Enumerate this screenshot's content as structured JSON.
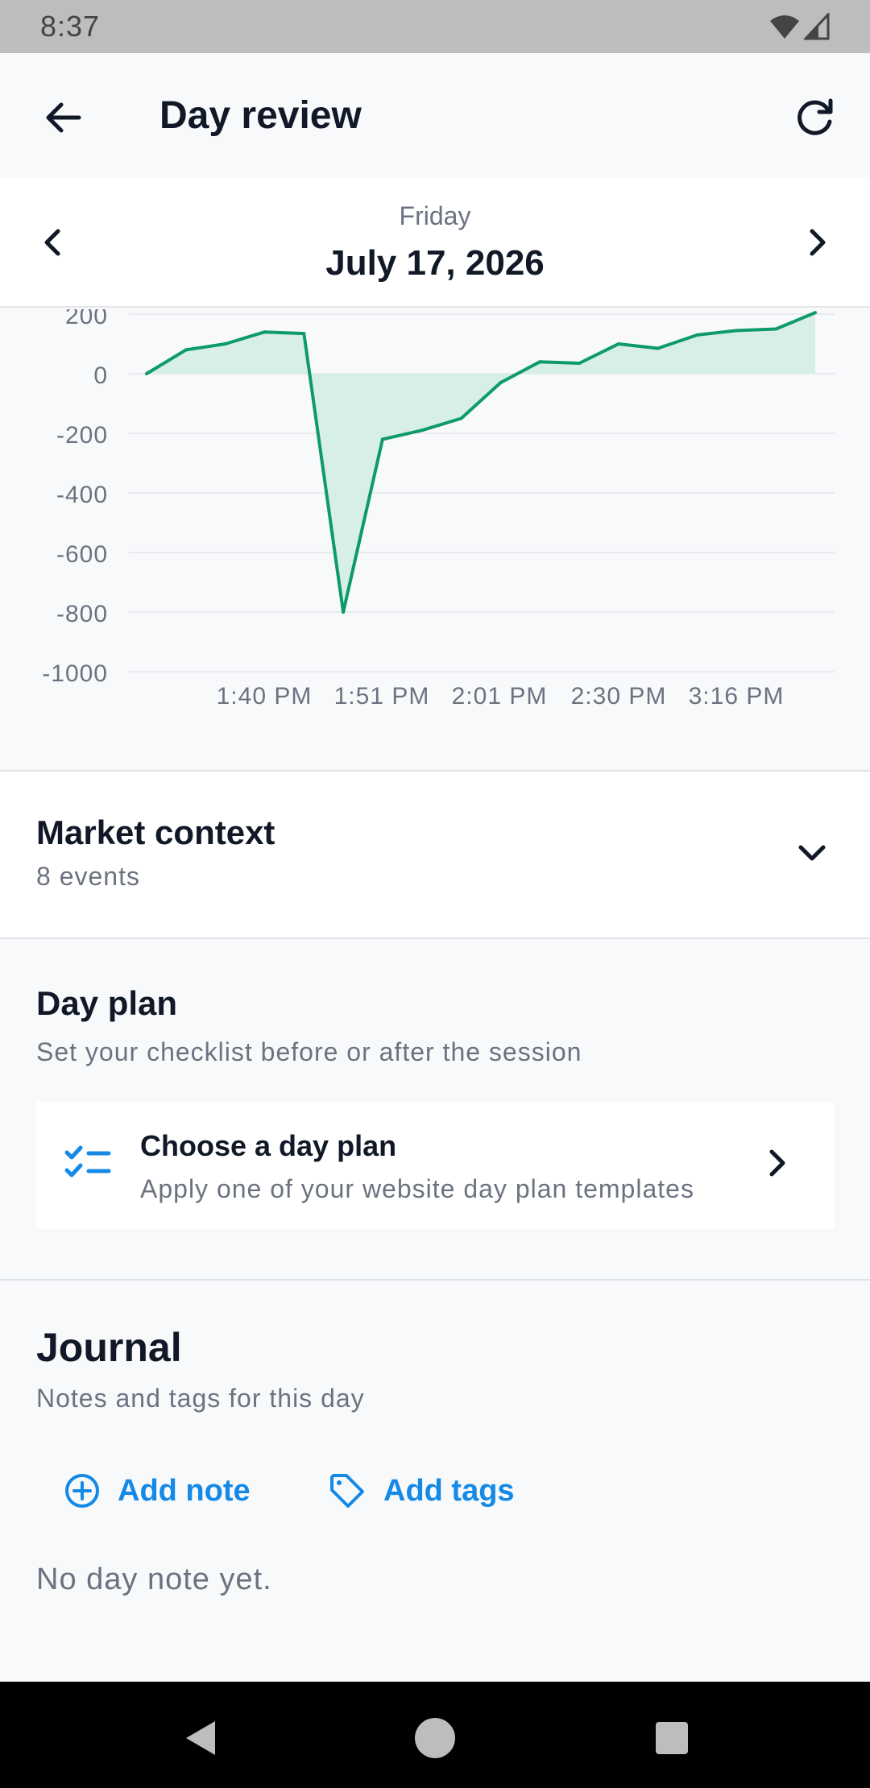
{
  "status_bar": {
    "time": "8:37"
  },
  "header": {
    "title": "Day review"
  },
  "date_nav": {
    "weekday": "Friday",
    "date": "July 17, 2026"
  },
  "chart_data": {
    "type": "area",
    "title": "",
    "xlabel": "",
    "ylabel": "",
    "ylim": [
      -1000,
      200
    ],
    "y_ticks": [
      "200",
      "0",
      "-200",
      "-400",
      "-600",
      "-800",
      "-1000"
    ],
    "y_tick_values": [
      200,
      0,
      -200,
      -400,
      -600,
      -800,
      -1000
    ],
    "x_ticks": [
      "1:40 PM",
      "1:51 PM",
      "2:01 PM",
      "2:30 PM",
      "3:16 PM"
    ],
    "grid": true,
    "series": [
      {
        "color": "#0e9a6b",
        "fill": "#d7efe6",
        "values": [
          0,
          80,
          100,
          140,
          135,
          -800,
          -220,
          -190,
          -150,
          -30,
          40,
          35,
          100,
          85,
          130,
          145,
          150,
          205
        ]
      }
    ]
  },
  "market": {
    "title": "Market context",
    "subtitle": "8 events"
  },
  "day_plan": {
    "title": "Day plan",
    "subtitle": "Set your checklist before or after the session",
    "card_title": "Choose a day plan",
    "card_subtitle": "Apply one of your website day plan templates"
  },
  "journal": {
    "title": "Journal",
    "subtitle": "Notes and tags for this day",
    "add_note": "Add note",
    "add_tags": "Add tags",
    "empty": "No day note yet."
  },
  "colors": {
    "accent": "#1589e6",
    "chart_line": "#0e9a6b"
  },
  "icons": [
    "wifi-icon",
    "signal-icon",
    "back-arrow-icon",
    "refresh-icon",
    "chevron-left-icon",
    "chevron-right-icon",
    "chevron-down-icon",
    "checklist-icon",
    "add-circle-icon",
    "tag-icon"
  ]
}
